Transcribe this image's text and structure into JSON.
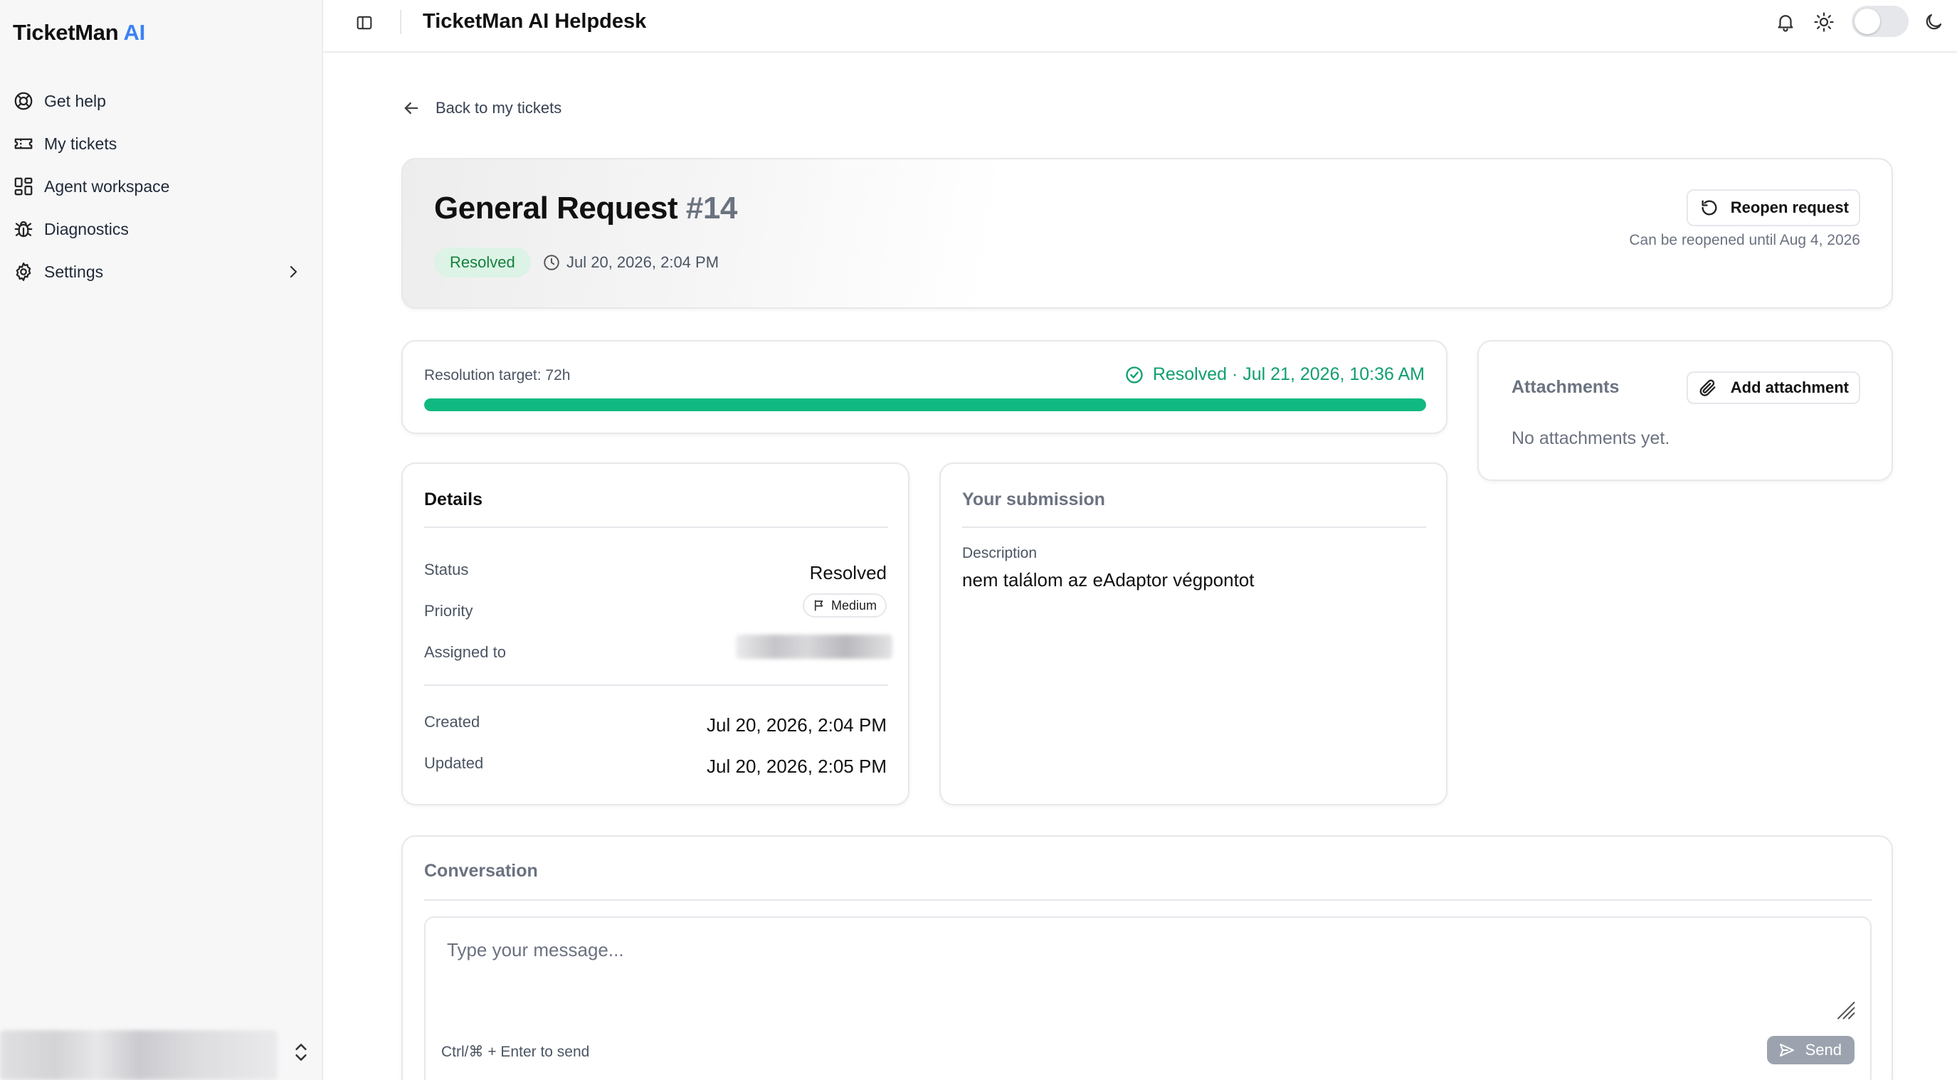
{
  "sidebar": {
    "brand_main": "TicketMan",
    "brand_accent": "AI",
    "items": [
      {
        "label": "Get help",
        "icon": "lifebuoy-icon"
      },
      {
        "label": "My tickets",
        "icon": "ticket-icon"
      },
      {
        "label": "Agent workspace",
        "icon": "layout-grid-icon"
      },
      {
        "label": "Diagnostics",
        "icon": "bug-icon"
      },
      {
        "label": "Settings",
        "icon": "gear-icon"
      }
    ]
  },
  "header": {
    "title": "TicketMan AI Helpdesk",
    "icons": [
      "sidebar-toggle-icon",
      "bell-icon",
      "sun-icon",
      "moon-icon"
    ]
  },
  "back_link": {
    "label": "Back to my tickets"
  },
  "ticket": {
    "title": "General Request",
    "number": "#14",
    "status": "Resolved",
    "created": "Jul 20, 2026, 2:04 PM",
    "reopen_label": "Reopen request",
    "reopen_note": "Can be reopened until Aug 4, 2026"
  },
  "sla": {
    "target_label": "Resolution target: 72h",
    "status_text": "Resolved · Jul 21, 2026, 10:36 AM",
    "progress_percent": 100
  },
  "attachments": {
    "title": "Attachments",
    "add_label": "Add attachment",
    "empty_text": "No attachments yet."
  },
  "details": {
    "title": "Details",
    "status_label": "Status",
    "status_value": "Resolved",
    "priority_label": "Priority",
    "priority_value": "Medium",
    "assigned_label": "Assigned to",
    "created_label": "Created",
    "created_value": "Jul 20, 2026, 2:04 PM",
    "updated_label": "Updated",
    "updated_value": "Jul 20, 2026, 2:05 PM"
  },
  "submission": {
    "title": "Your submission",
    "description_label": "Description",
    "description_value": "nem találom az eAdaptor végpontot"
  },
  "conversation": {
    "title": "Conversation",
    "placeholder": "Type your message...",
    "hint": "Ctrl/⌘ + Enter to send",
    "send_label": "Send"
  },
  "colors": {
    "brand_accent": "#3b82f6",
    "success": "#10b981",
    "success_text": "#0e9f6e",
    "badge_bg": "#dcf3e6"
  }
}
